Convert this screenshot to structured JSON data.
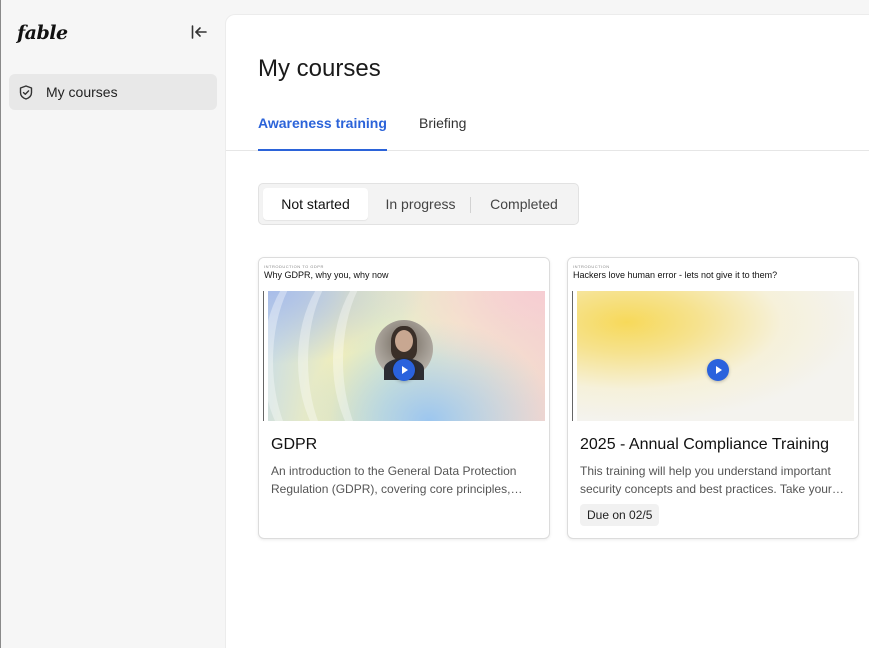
{
  "app": {
    "logo_text": "fable"
  },
  "sidebar": {
    "items": [
      {
        "label": "My courses",
        "icon": "shield-check-icon"
      }
    ]
  },
  "main": {
    "title": "My courses",
    "tabs": [
      {
        "label": "Awareness training",
        "active": true
      },
      {
        "label": "Briefing",
        "active": false
      }
    ],
    "filters": [
      {
        "label": "Not started",
        "selected": true
      },
      {
        "label": "In progress",
        "selected": false
      },
      {
        "label": "Completed",
        "selected": false
      }
    ],
    "courses": [
      {
        "eyebrow": "INTRODUCTION TO GDPR",
        "thumb_title": "Why GDPR, why you, why now",
        "title": "GDPR",
        "description": "An introduction to the General Data Protection Regulation (GDPR), covering core principles, individual rights, and how to handle personal data responsibly.",
        "badge": ""
      },
      {
        "eyebrow": "INTRODUCTION",
        "thumb_title": "Hackers love human error - lets not give it to them?",
        "title": "2025 - Annual Compliance Training",
        "description": "This training will help you understand important security concepts and best practices. Take your time and complete every module.",
        "badge": "Due on 02/5"
      }
    ]
  },
  "colors": {
    "accent": "#2b63d9",
    "play": "#2a62dd"
  }
}
